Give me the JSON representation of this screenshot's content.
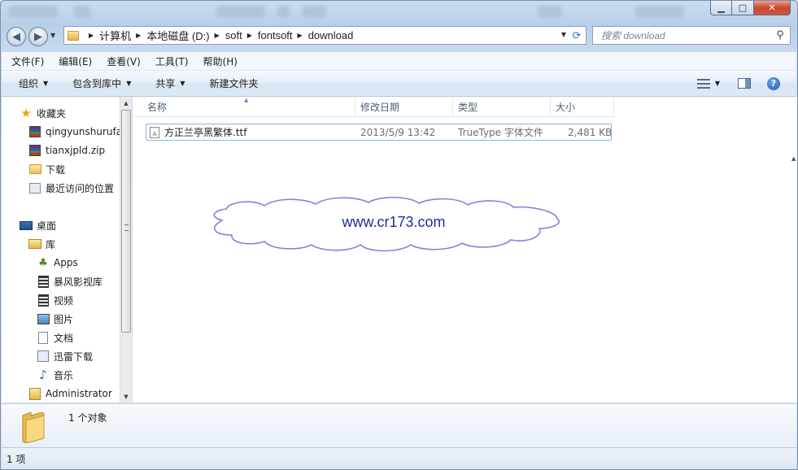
{
  "nav": {
    "back_label": "◀",
    "forward_label": "▶",
    "breadcrumbs": [
      "计算机",
      "本地磁盘 (D:)",
      "soft",
      "fontsoft",
      "download"
    ],
    "search_placeholder": "搜索 download"
  },
  "menubar": [
    "文件(F)",
    "编辑(E)",
    "查看(V)",
    "工具(T)",
    "帮助(H)"
  ],
  "toolbar": {
    "organize": "组织",
    "include_in_library": "包含到库中",
    "share": "共享",
    "new_folder": "新建文件夹"
  },
  "sidebar": {
    "items": [
      {
        "label": "收藏夹",
        "icon": "star-icon"
      },
      {
        "label": "qingyunshurufa",
        "icon": "winrar-archive-icon"
      },
      {
        "label": "tianxjpld.zip",
        "icon": "winrar-archive-icon"
      },
      {
        "label": "下载",
        "icon": "download-folder-icon"
      },
      {
        "label": "最近访问的位置",
        "icon": "recent-places-icon"
      },
      {
        "label": "桌面",
        "icon": "desktop-icon"
      },
      {
        "label": "库",
        "icon": "library-icon"
      },
      {
        "label": "Apps",
        "icon": "apps-icon"
      },
      {
        "label": "暴风影视库",
        "icon": "video-library-icon"
      },
      {
        "label": "视频",
        "icon": "video-icon"
      },
      {
        "label": "图片",
        "icon": "picture-icon"
      },
      {
        "label": "文档",
        "icon": "document-icon"
      },
      {
        "label": "迅雷下载",
        "icon": "thunder-download-icon"
      },
      {
        "label": "音乐",
        "icon": "music-icon"
      },
      {
        "label": "Administrator",
        "icon": "user-folder-icon"
      }
    ]
  },
  "columns": {
    "name": "名称",
    "modified": "修改日期",
    "type": "类型",
    "size": "大小"
  },
  "files": [
    {
      "name": "方正兰亭黑繁体.ttf",
      "modified": "2013/5/9 13:42",
      "type": "TrueType 字体文件",
      "size": "2,481 KB"
    }
  ],
  "watermark": "www.cr173.com",
  "details": {
    "count": "1 个对象"
  },
  "status": {
    "text": "1 项"
  },
  "colors": {
    "accent": "#1f2c9c",
    "cloud_stroke": "#8b7fd8",
    "selection_border": "#8fb4dd"
  }
}
